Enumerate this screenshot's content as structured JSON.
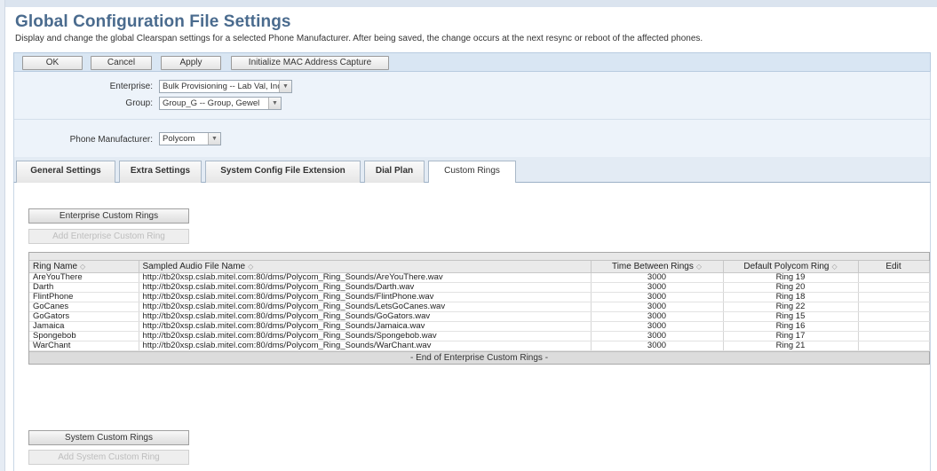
{
  "page": {
    "title": "Global Configuration File Settings",
    "subtitle": "Display and change the global Clearspan settings for a selected Phone Manufacturer. After being saved, the change occurs at the next resync or reboot of the affected phones."
  },
  "toolbar": {
    "ok": "OK",
    "cancel": "Cancel",
    "apply": "Apply",
    "init_mac": "Initialize MAC Address Capture"
  },
  "form": {
    "enterprise_label": "Enterprise:",
    "enterprise_value": "Bulk Provisioning -- Lab Val, Inc",
    "group_label": "Group:",
    "group_value": "Group_G -- Group, Gewel",
    "manufacturer_label": "Phone Manufacturer:",
    "manufacturer_value": "Polycom"
  },
  "tabs": [
    {
      "label": "General Settings"
    },
    {
      "label": "Extra Settings"
    },
    {
      "label": "System Config File Extension"
    },
    {
      "label": "Dial Plan"
    },
    {
      "label": "Custom Rings"
    }
  ],
  "enterprise_section": {
    "button": "Enterprise Custom Rings",
    "add_button": "Add Enterprise Custom Ring"
  },
  "table": {
    "columns": [
      "Ring Name",
      "Sampled Audio File Name",
      "Time Between Rings",
      "Default Polycom Ring",
      "Edit"
    ],
    "rows": [
      [
        "AreYouThere",
        "http://tb20xsp.cslab.mitel.com:80/dms/Polycom_Ring_Sounds/AreYouThere.wav",
        "3000",
        "Ring 19",
        ""
      ],
      [
        "Darth",
        "http://tb20xsp.cslab.mitel.com:80/dms/Polycom_Ring_Sounds/Darth.wav",
        "3000",
        "Ring 20",
        ""
      ],
      [
        "FlintPhone",
        "http://tb20xsp.cslab.mitel.com:80/dms/Polycom_Ring_Sounds/FlintPhone.wav",
        "3000",
        "Ring 18",
        ""
      ],
      [
        "GoCanes",
        "http://tb20xsp.cslab.mitel.com:80/dms/Polycom_Ring_Sounds/LetsGoCanes.wav",
        "3000",
        "Ring 22",
        ""
      ],
      [
        "GoGators",
        "http://tb20xsp.cslab.mitel.com:80/dms/Polycom_Ring_Sounds/GoGators.wav",
        "3000",
        "Ring 15",
        ""
      ],
      [
        "Jamaica",
        "http://tb20xsp.cslab.mitel.com:80/dms/Polycom_Ring_Sounds/Jamaica.wav",
        "3000",
        "Ring 16",
        ""
      ],
      [
        "Spongebob",
        "http://tb20xsp.cslab.mitel.com:80/dms/Polycom_Ring_Sounds/Spongebob.wav",
        "3000",
        "Ring 17",
        ""
      ],
      [
        "WarChant",
        "http://tb20xsp.cslab.mitel.com:80/dms/Polycom_Ring_Sounds/WarChant.wav",
        "3000",
        "Ring 21",
        ""
      ]
    ],
    "footer": "- End of Enterprise Custom Rings -"
  },
  "system_section": {
    "button": "System Custom Rings",
    "add_button": "Add System Custom Ring"
  },
  "icons": {
    "sort": "sort-icon",
    "dropdown": "chevron-down-icon"
  }
}
